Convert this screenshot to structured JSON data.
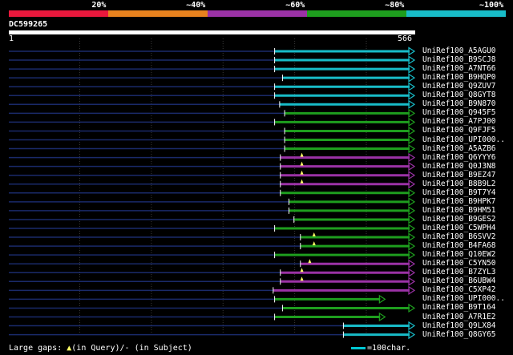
{
  "legend": {
    "labels": [
      {
        "text": "20%",
        "pos": 0.2
      },
      {
        "text": "~40%",
        "pos": 0.4
      },
      {
        "text": "~60%",
        "pos": 0.6
      },
      {
        "text": "~80%",
        "pos": 0.8
      },
      {
        "text": "~100%",
        "pos": 1.0
      }
    ],
    "colors": [
      "#e8183c",
      "#e8821e",
      "#9b32a6",
      "#1e9e1e",
      "#18bcc8"
    ]
  },
  "query": {
    "id": "DC599265",
    "start": "1",
    "end": "566",
    "length": 566
  },
  "hits": [
    {
      "label": "UniRef100_A5AGU0",
      "start": 372,
      "end": 566,
      "color": "#18bcc8",
      "gap": null
    },
    {
      "label": "UniRef100_B9SCJ8",
      "start": 372,
      "end": 566,
      "color": "#18bcc8",
      "gap": null
    },
    {
      "label": "UniRef100_A7NT66",
      "start": 372,
      "end": 566,
      "color": "#18bcc8",
      "gap": null
    },
    {
      "label": "UniRef100_B9HQP0",
      "start": 383,
      "end": 566,
      "color": "#18bcc8",
      "gap": null
    },
    {
      "label": "UniRef100_Q9ZUV7",
      "start": 372,
      "end": 566,
      "color": "#18bcc8",
      "gap": null
    },
    {
      "label": "UniRef100_Q8GYT8",
      "start": 372,
      "end": 566,
      "color": "#18bcc8",
      "gap": null
    },
    {
      "label": "UniRef100_B9N870",
      "start": 379,
      "end": 566,
      "color": "#18bcc8",
      "gap": null
    },
    {
      "label": "UniRef100_Q945F5",
      "start": 386,
      "end": 566,
      "color": "#1e9e1e",
      "gap": null
    },
    {
      "label": "UniRef100_A7PJ00",
      "start": 372,
      "end": 566,
      "color": "#1e9e1e",
      "gap": null
    },
    {
      "label": "UniRef100_Q9FJF5",
      "start": 386,
      "end": 566,
      "color": "#1e9e1e",
      "gap": null
    },
    {
      "label": "UniRef100_UPI000..",
      "start": 386,
      "end": 566,
      "color": "#1e9e1e",
      "gap": null
    },
    {
      "label": "UniRef100_A5AZB6",
      "start": 386,
      "end": 566,
      "color": "#1e9e1e",
      "gap": null
    },
    {
      "label": "UniRef100_Q6YYY6",
      "start": 380,
      "end": 566,
      "color": "#9b32a6",
      "gap": 410
    },
    {
      "label": "UniRef100_Q0J3N8",
      "start": 380,
      "end": 566,
      "color": "#9b32a6",
      "gap": 410
    },
    {
      "label": "UniRef100_B9EZ47",
      "start": 380,
      "end": 566,
      "color": "#9b32a6",
      "gap": 410
    },
    {
      "label": "UniRef100_B8B9L2",
      "start": 380,
      "end": 566,
      "color": "#9b32a6",
      "gap": 410
    },
    {
      "label": "UniRef100_B9T7Y4",
      "start": 380,
      "end": 566,
      "color": "#1e9e1e",
      "gap": null
    },
    {
      "label": "UniRef100_B9HPK7",
      "start": 392,
      "end": 566,
      "color": "#1e9e1e",
      "gap": null
    },
    {
      "label": "UniRef100_B9HM51",
      "start": 392,
      "end": 566,
      "color": "#1e9e1e",
      "gap": null
    },
    {
      "label": "UniRef100_B9GES2",
      "start": 399,
      "end": 566,
      "color": "#1e9e1e",
      "gap": null
    },
    {
      "label": "UniRef100_C5WPH4",
      "start": 372,
      "end": 566,
      "color": "#1e9e1e",
      "gap": null
    },
    {
      "label": "UniRef100_B6SVV2",
      "start": 408,
      "end": 566,
      "color": "#1e9e1e",
      "gap": 427
    },
    {
      "label": "UniRef100_B4FA68",
      "start": 408,
      "end": 566,
      "color": "#1e9e1e",
      "gap": 427
    },
    {
      "label": "UniRef100_Q10EW2",
      "start": 372,
      "end": 566,
      "color": "#1e9e1e",
      "gap": null
    },
    {
      "label": "UniRef100_C5YN50",
      "start": 408,
      "end": 566,
      "color": "#9b32a6",
      "gap": 421
    },
    {
      "label": "UniRef100_B7ZYL3",
      "start": 380,
      "end": 566,
      "color": "#9b32a6",
      "gap": 410
    },
    {
      "label": "UniRef100_B6UBW4",
      "start": 380,
      "end": 566,
      "color": "#9b32a6",
      "gap": 410
    },
    {
      "label": "UniRef100_C5XP42",
      "start": 370,
      "end": 566,
      "color": "#9b32a6",
      "gap": null
    },
    {
      "label": "UniRef100_UPI000..",
      "start": 372,
      "end": 525,
      "color": "#1e9e1e",
      "gap": null
    },
    {
      "label": "UniRef100_B9T164",
      "start": 383,
      "end": 566,
      "color": "#1e9e1e",
      "gap": null
    },
    {
      "label": "UniRef100_A7R1E2",
      "start": 372,
      "end": 525,
      "color": "#1e9e1e",
      "gap": null
    },
    {
      "label": "UniRef100_Q9LX84",
      "start": 468,
      "end": 566,
      "color": "#18bcc8",
      "gap": null
    },
    {
      "label": "UniRef100_Q8GY65",
      "start": 468,
      "end": 566,
      "color": "#18bcc8",
      "gap": null
    }
  ],
  "footer": {
    "large_gaps_prefix": "Large gaps: ",
    "query_marker": "▲",
    "query_text": "(in Query)/",
    "subject_marker": "-",
    "subject_text": " (in Subject)",
    "scale_text": "=100char."
  }
}
